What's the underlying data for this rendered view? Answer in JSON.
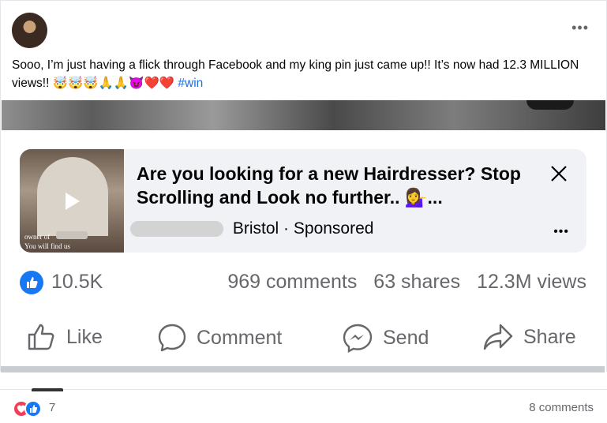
{
  "post": {
    "text": "Sooo, I’m just having a flick through Facebook and my king pin just came up!! It’s now had 12.3 MILLION views!! 🤯🤯🤯🙏🙏😈❤️❤️",
    "hashtag": "#win"
  },
  "reel": {
    "title": "Are you looking for a new Hairdresser? Stop Scrolling and Look no further.. 💁‍♀️...",
    "thumbnail_caption_1": "owner of",
    "thumbnail_caption_2": "You will find us",
    "location": "Bristol",
    "separator": "·",
    "sponsored": "Sponsored"
  },
  "stats": {
    "likes": "10.5K",
    "comments": "969 comments",
    "shares": "63 shares",
    "views": "12.3M views"
  },
  "actions": {
    "like": "Like",
    "comment": "Comment",
    "send": "Send",
    "share": "Share"
  },
  "next_post": {
    "reaction_count": "7",
    "comments": "8 comments"
  },
  "colors": {
    "accent": "#1877f2",
    "hashtag": "#216fdb",
    "muted": "#65676b",
    "heart": "#f33e58"
  },
  "icons": [
    "avatar",
    "more-icon",
    "close-icon",
    "play-icon",
    "like-reaction-icon",
    "thumbs-up-icon",
    "comment-icon",
    "messenger-icon",
    "share-icon",
    "heart-reaction-icon"
  ]
}
